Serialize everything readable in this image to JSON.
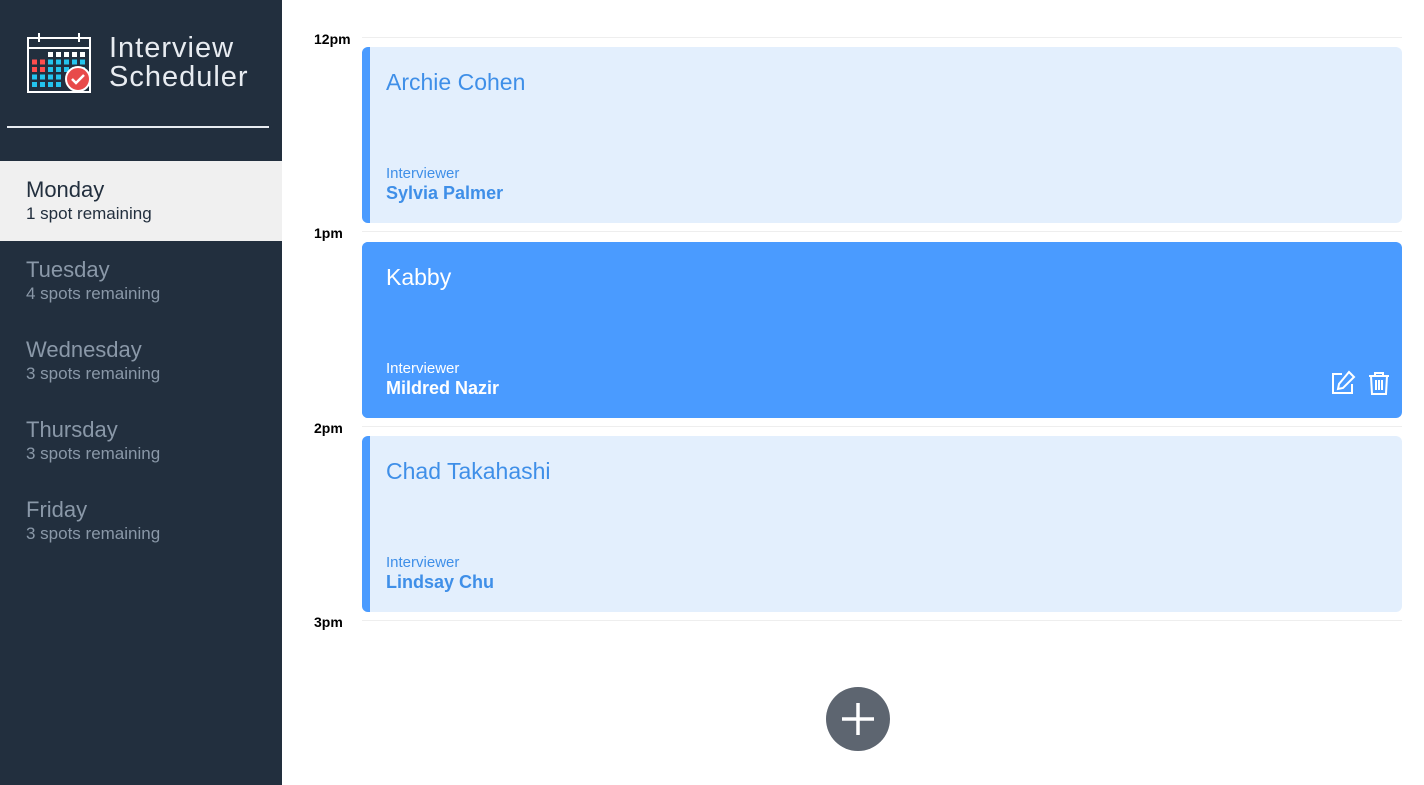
{
  "app": {
    "title_line1": "Interview",
    "title_line2": "Scheduler"
  },
  "days": [
    {
      "name": "Monday",
      "spots": "1 spot remaining",
      "selected": true
    },
    {
      "name": "Tuesday",
      "spots": "4 spots remaining",
      "selected": false
    },
    {
      "name": "Wednesday",
      "spots": "3 spots remaining",
      "selected": false
    },
    {
      "name": "Thursday",
      "spots": "3 spots remaining",
      "selected": false
    },
    {
      "name": "Friday",
      "spots": "3 spots remaining",
      "selected": false
    }
  ],
  "times": [
    "12pm",
    "1pm",
    "2pm",
    "3pm"
  ],
  "appointments": [
    {
      "student": "Archie Cohen",
      "interviewer_label": "Interviewer",
      "interviewer": "Sylvia Palmer",
      "state": "light"
    },
    {
      "student": "Kabby",
      "interviewer_label": "Interviewer",
      "interviewer": "Mildred Nazir",
      "state": "active",
      "actions": [
        "edit-icon",
        "trash-icon"
      ]
    },
    {
      "student": "Chad Takahashi",
      "interviewer_label": "Interviewer",
      "interviewer": "Lindsay Chu",
      "state": "light"
    }
  ],
  "add_button": {
    "icon": "plus-icon"
  },
  "colors": {
    "sidebar": "#222f3e",
    "accent": "#4a9bff",
    "appointment_light": "#e3effd",
    "add_button": "#5d6570"
  }
}
